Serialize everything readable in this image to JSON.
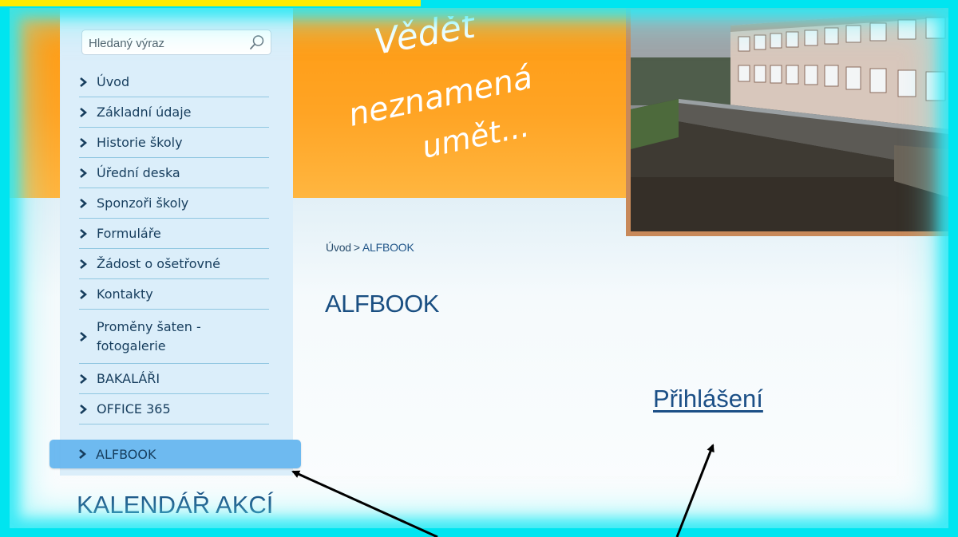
{
  "header": {
    "slogan_line1": "Vědět",
    "slogan_line2": "neznamená",
    "slogan_line3": "umět..."
  },
  "search": {
    "placeholder": "Hledaný výraz"
  },
  "sidebar": {
    "items": [
      {
        "label": "Úvod"
      },
      {
        "label": "Základní údaje"
      },
      {
        "label": "Historie školy"
      },
      {
        "label": "Úřední deska"
      },
      {
        "label": "Sponzoři školy"
      },
      {
        "label": "Formuláře"
      },
      {
        "label": "Žádost o ošetřovné"
      },
      {
        "label": "Kontakty"
      },
      {
        "label": "Proměny šaten -",
        "label2": "fotogalerie"
      },
      {
        "label": "BAKALÁŘI"
      },
      {
        "label": "OFFICE 365"
      },
      {
        "label": "ALFBOOK"
      }
    ],
    "active_index": 11
  },
  "breadcrumb": {
    "home": "Úvod",
    "separator": ">",
    "current": "ALFBOOK"
  },
  "main": {
    "title": "ALFBOOK",
    "login_link": "Přihlášení"
  },
  "calendar": {
    "heading": "KALENDÁŘ AKCÍ"
  },
  "colors": {
    "frame_glow": "#00e5f0",
    "header_orange": "#ff9b12",
    "sidebar_bg": "#dbeefa",
    "active_item": "#6ebaf0",
    "link_blue": "#1b4f86",
    "highlight_strip": "#ffeb00"
  },
  "icons": [
    "search-icon",
    "chevron-right-icon",
    "annotation-arrow"
  ]
}
